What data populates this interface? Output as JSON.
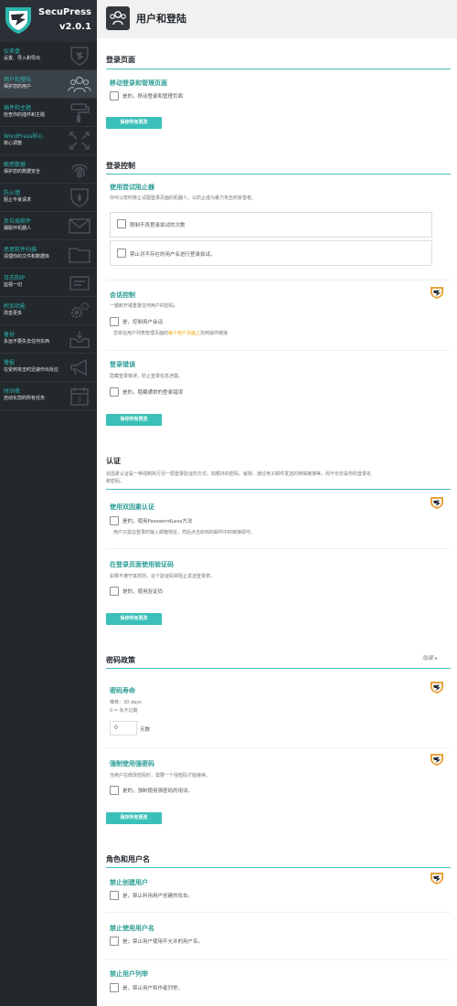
{
  "app": {
    "name": "SecuPress",
    "version": "v2.0.1"
  },
  "nav": [
    {
      "title": "仪表盘",
      "sub": "设置、导入和导出",
      "icon": "shield-icon"
    },
    {
      "title": "用户和登陆",
      "sub": "保护您的用户",
      "icon": "users-icon",
      "active": true
    },
    {
      "title": "插件和主题",
      "sub": "检查你的插件和主题",
      "icon": "paint-roller-icon"
    },
    {
      "title": "WordPress核心",
      "sub": "核心调整",
      "icon": "core-arrows-icon"
    },
    {
      "title": "敏感数据",
      "sub": "保护您的数据安全",
      "icon": "fingerprint-icon"
    },
    {
      "title": "防火墙",
      "sub": "阻止不良请求",
      "icon": "firewall-shield-icon"
    },
    {
      "title": "反垃圾邮件",
      "sub": "摆脱坏机器人",
      "icon": "mail-icon"
    },
    {
      "title": "恶意软件扫描",
      "sub": "清理你的文件和数据库",
      "icon": "folder-icon"
    },
    {
      "title": "日志和IP",
      "sub": "监视一切",
      "icon": "log-icon"
    },
    {
      "title": "附加功能",
      "sub": "改善更多",
      "icon": "gears-icon"
    },
    {
      "title": "备份",
      "sub": "永远不要失去任何东西",
      "icon": "inbox-icon"
    },
    {
      "title": "警报",
      "sub": "在受到攻击时迅速作出反应",
      "icon": "megaphone-icon"
    },
    {
      "title": "时间表",
      "sub": "自动化您的所有任务",
      "icon": "calendar-icon"
    }
  ],
  "page": {
    "title": "用户和登陆"
  },
  "save_label": "保存所有更改",
  "sec_login_page": {
    "title": "登录页面",
    "move_title": "移动登录和管理页面",
    "move_cb": "是的，移动登录和管理页面"
  },
  "sec_login_control": {
    "title": "登录控制",
    "attempts_title": "使用尝试阻止器",
    "attempts_desc": "你可以暂时禁止试图登录页面的机器人，以防止成为暴力攻击的受害者。",
    "attempts_cb1": "限制不良登录尝试的次数",
    "attempts_cb2": "禁止对不存在的用户名进行登录尝试。",
    "session_title": "会话控制",
    "session_desc": "一键断开或重置任何用户的密码。",
    "session_cb": "是，控制用户会话",
    "session_note_pre": "您将在用户列表管理页面的",
    "session_note_link": "每个用户页面上",
    "session_note_post": "找到操作链接",
    "error_title": "登录错误",
    "error_desc": "隐藏登录错误，防止登录信息泄露。",
    "error_cb": "是的，隐藏通常的登录错误"
  },
  "sec_auth": {
    "title": "认证",
    "desc1": "双因素认证是一种强制执行另一层登录验证的方式，如额外的密码、秘钥、通过电子邮件发送的特殊链接等。而不仅仅是你的登录名",
    "desc2": "和密码。",
    "tfa_title": "使用双因素认证",
    "tfa_cb": "是的，使用PasswordLess方法",
    "tfa_note": "用户只需在登录时输入邮箱地址，然后点击收到的邮件中的链接即可。",
    "captcha_title": "在登录页面使用验证码",
    "captcha_desc": "如果不遵守其规则，这个验证码将阻止发送登录表。",
    "captcha_cb": "是的，使用验证码"
  },
  "sec_password": {
    "title": "密码政策",
    "toggle": "隐藏",
    "life_title": "密码寿命",
    "life_desc1": "推荐：30 days",
    "life_desc2": "0 = 永不过期",
    "life_value": "0",
    "life_unit": "天数",
    "strong_title": "强制使用强密码",
    "strong_desc": "当用户在修改密码时，需要一个强密码才能继续。",
    "strong_cb": "是的，强制使用强密码的用法。"
  },
  "sec_roles": {
    "title": "角色和用户名",
    "block_title": "禁止创建用户",
    "block_cb": "是，禁止利用用户创建的攻击。",
    "names_title": "禁止使用用户名",
    "names_cb": "是，禁止用户使用不允许的用户名。",
    "list_title": "禁止用户列举",
    "list_cb": "是，禁止用户和作者列举。"
  },
  "colors": {
    "accent": "#2bb6ad",
    "sidebar": "#23282d",
    "button": "#3ac0b8",
    "link": "#f0a500"
  }
}
